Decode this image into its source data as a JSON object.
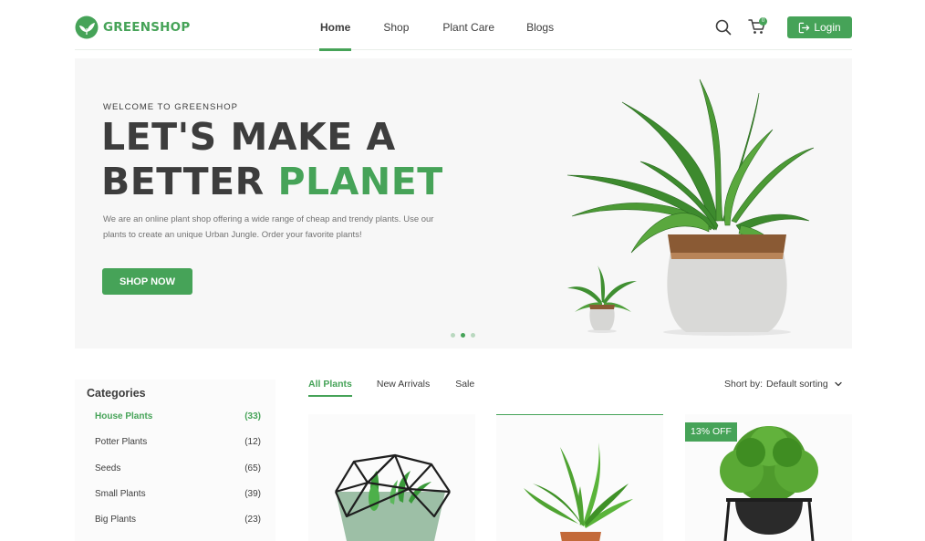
{
  "brand": {
    "name": "GREENSHOP"
  },
  "header": {
    "nav": [
      {
        "label": "Home",
        "active": true
      },
      {
        "label": "Shop",
        "active": false
      },
      {
        "label": "Plant Care",
        "active": false
      },
      {
        "label": "Blogs",
        "active": false
      }
    ],
    "cart_count": "0",
    "login_label": "Login"
  },
  "hero": {
    "welcome": "Welcome to GreenShop",
    "title_line1": "LET'S MAKE A",
    "title_line2_prefix": "BETTER ",
    "title_line2_highlight": "PLANET",
    "description": "We are an online plant shop offering a wide range of cheap and trendy plants. Use our plants to create an unique Urban Jungle. Order your favorite plants!",
    "cta_label": "SHOP NOW",
    "slides": 3,
    "active_slide": 2
  },
  "categories": {
    "title": "Categories",
    "items": [
      {
        "label": "House Plants",
        "count": "(33)",
        "active": true
      },
      {
        "label": "Potter Plants",
        "count": "(12)",
        "active": false
      },
      {
        "label": "Seeds",
        "count": "(65)",
        "active": false
      },
      {
        "label": "Small Plants",
        "count": "(39)",
        "active": false
      },
      {
        "label": "Big Plants",
        "count": "(23)",
        "active": false
      }
    ]
  },
  "product_tabs": [
    {
      "label": "All Plants",
      "active": true
    },
    {
      "label": "New Arrivals",
      "active": false
    },
    {
      "label": "Sale",
      "active": false
    }
  ],
  "sort": {
    "label": "Short by:",
    "value": "Default sorting"
  },
  "products": [
    {
      "badge": ""
    },
    {
      "badge": ""
    },
    {
      "badge": "13% OFF"
    }
  ],
  "colors": {
    "accent": "#46a358",
    "text": "#3d3d3d",
    "muted": "#727272"
  },
  "icons": [
    "leaf-logo-icon",
    "search-icon",
    "cart-icon",
    "logout-icon",
    "chevron-down-icon"
  ]
}
